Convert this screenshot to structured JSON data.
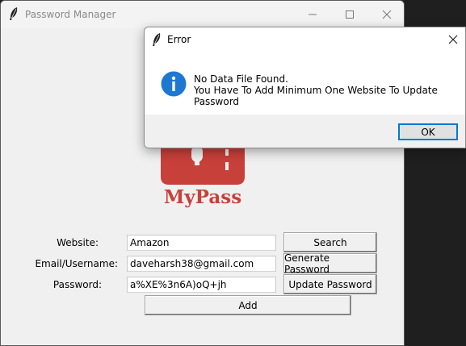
{
  "main_window": {
    "title": "Password Manager",
    "form": {
      "website_label": "Website:",
      "website_value": "Amazon",
      "email_label": "Email/Username:",
      "email_value": "daveharsh38@gmail.com",
      "password_label": "Password:",
      "password_value": "a%XE%3n6A)oQ+jh",
      "search_button": "Search",
      "generate_button": "Generate Password",
      "update_button": "Update Password",
      "add_button": "Add"
    },
    "logo_text": "MyPass"
  },
  "dialog": {
    "title": "Error",
    "message_line1": "No Data File Found.",
    "message_line2": "You Have To Add Minimum One Website To Update Password",
    "ok_label": "OK"
  },
  "colors": {
    "logo_red": "#c8403a",
    "info_blue": "#1e78d2",
    "focus_blue": "#0078d4"
  }
}
